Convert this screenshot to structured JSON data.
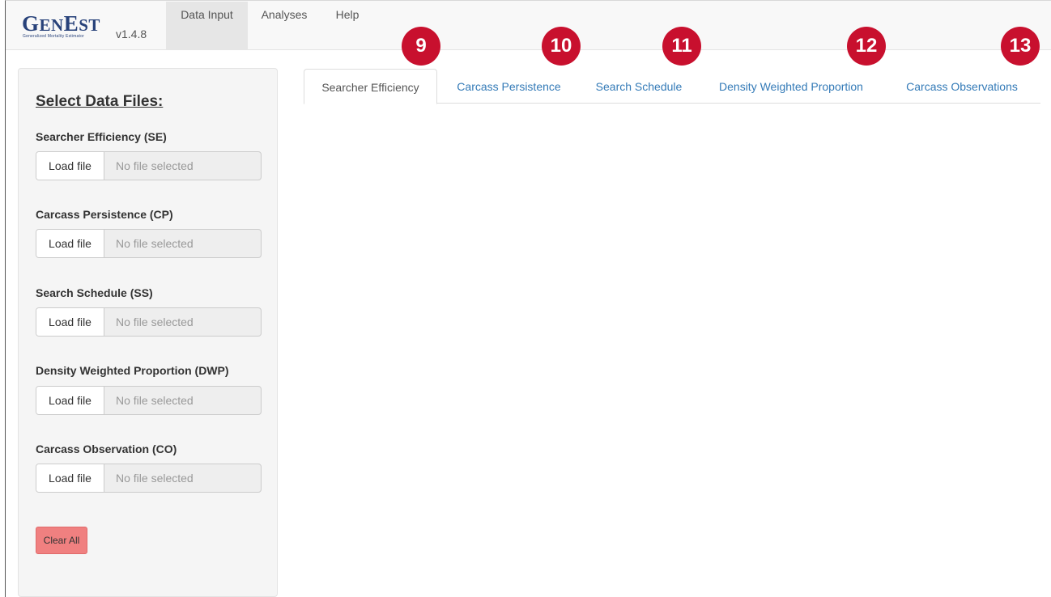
{
  "app": {
    "logo_text_big": "G",
    "logo_text_small": "EN",
    "logo_text_big2": "E",
    "logo_text_small2": "ST",
    "logo_tagline": "Generalized Mortality Estimator",
    "version": "v1.4.8"
  },
  "navbar": {
    "tabs": [
      {
        "label": "Data Input",
        "active": true
      },
      {
        "label": "Analyses",
        "active": false
      },
      {
        "label": "Help",
        "active": false
      }
    ]
  },
  "sidebar": {
    "title": "Select Data Files:",
    "files": [
      {
        "label": "Searcher Efficiency (SE)",
        "button": "Load file",
        "status": "No file selected"
      },
      {
        "label": "Carcass Persistence (CP)",
        "button": "Load file",
        "status": "No file selected"
      },
      {
        "label": "Search Schedule (SS)",
        "button": "Load file",
        "status": "No file selected"
      },
      {
        "label": "Density Weighted Proportion (DWP)",
        "button": "Load file",
        "status": "No file selected"
      },
      {
        "label": "Carcass Observation (CO)",
        "button": "Load file",
        "status": "No file selected"
      }
    ],
    "clear_label": "Clear All"
  },
  "main": {
    "tabs": [
      {
        "label": "Searcher Efficiency",
        "active": true
      },
      {
        "label": "Carcass Persistence",
        "active": false
      },
      {
        "label": "Search Schedule",
        "active": false
      },
      {
        "label": "Density Weighted Proportion",
        "active": false
      },
      {
        "label": "Carcass Observations",
        "active": false
      }
    ]
  },
  "callouts": [
    "9",
    "10",
    "11",
    "12",
    "13"
  ],
  "colors": {
    "callout": "#c8102e",
    "link": "#337ab7",
    "logo": "#28427a",
    "clear_button": "#f08080"
  }
}
